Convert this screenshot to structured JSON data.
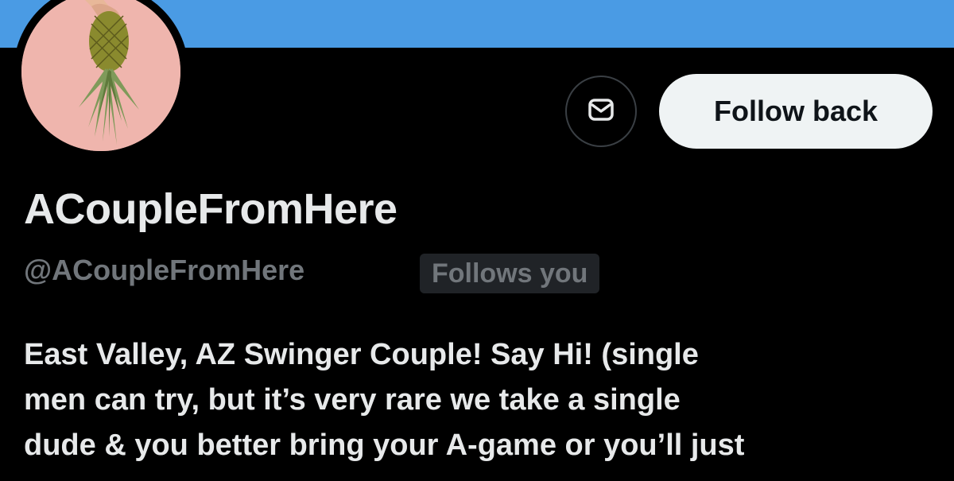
{
  "profile": {
    "display_name": "ACoupleFromHere",
    "handle": "@ACoupleFromHere",
    "follows_you_badge": "Follows you",
    "avatar_icon": "pineapple-photo",
    "bio_lines": [
      "East Valley, AZ Swinger Couple! Say Hi! (single",
      "men can try, but it’s very rare we take a single",
      "dude & you better bring your A-game or you’ll just"
    ]
  },
  "actions": {
    "message_icon": "envelope-icon",
    "follow_label": "Follow back"
  },
  "colors": {
    "banner": "#4a9be4",
    "background": "#000000",
    "primary_text": "#e7e9ea",
    "secondary_text": "#71767b",
    "follow_button_bg": "#eff3f4",
    "badge_bg": "#202327"
  }
}
